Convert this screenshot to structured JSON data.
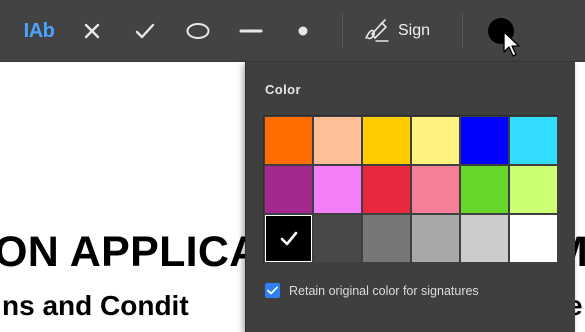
{
  "toolbar": {
    "tools": [
      {
        "icon": "text-field-icon",
        "label": "IAb"
      },
      {
        "icon": "cross-mark-icon"
      },
      {
        "icon": "checkmark-icon"
      },
      {
        "icon": "ellipse-icon"
      },
      {
        "icon": "line-icon"
      },
      {
        "icon": "dot-icon"
      }
    ],
    "sign": {
      "icon": "pen-signature-icon",
      "label": "Sign"
    },
    "current_color": "#000000"
  },
  "document": {
    "line1_left": "ON APPLICA",
    "line1_right": "M",
    "line2_left": "ns and Condit",
    "line2_right": "e"
  },
  "color_popup": {
    "title": "Color",
    "swatches": [
      "#ff6c00",
      "#ffbf99",
      "#ffcc00",
      "#fff27f",
      "#0000ff",
      "#33ddff",
      "#a3298f",
      "#f27ff7",
      "#e8283c",
      "#f57f97",
      "#66d62b",
      "#ccff73",
      "#000000",
      "#484848",
      "#777777",
      "#a8a8a8",
      "#cccccc",
      "#ffffff"
    ],
    "selected_index": 12,
    "retain_checkbox": {
      "label": "Retain original color for signatures",
      "checked": true
    }
  }
}
